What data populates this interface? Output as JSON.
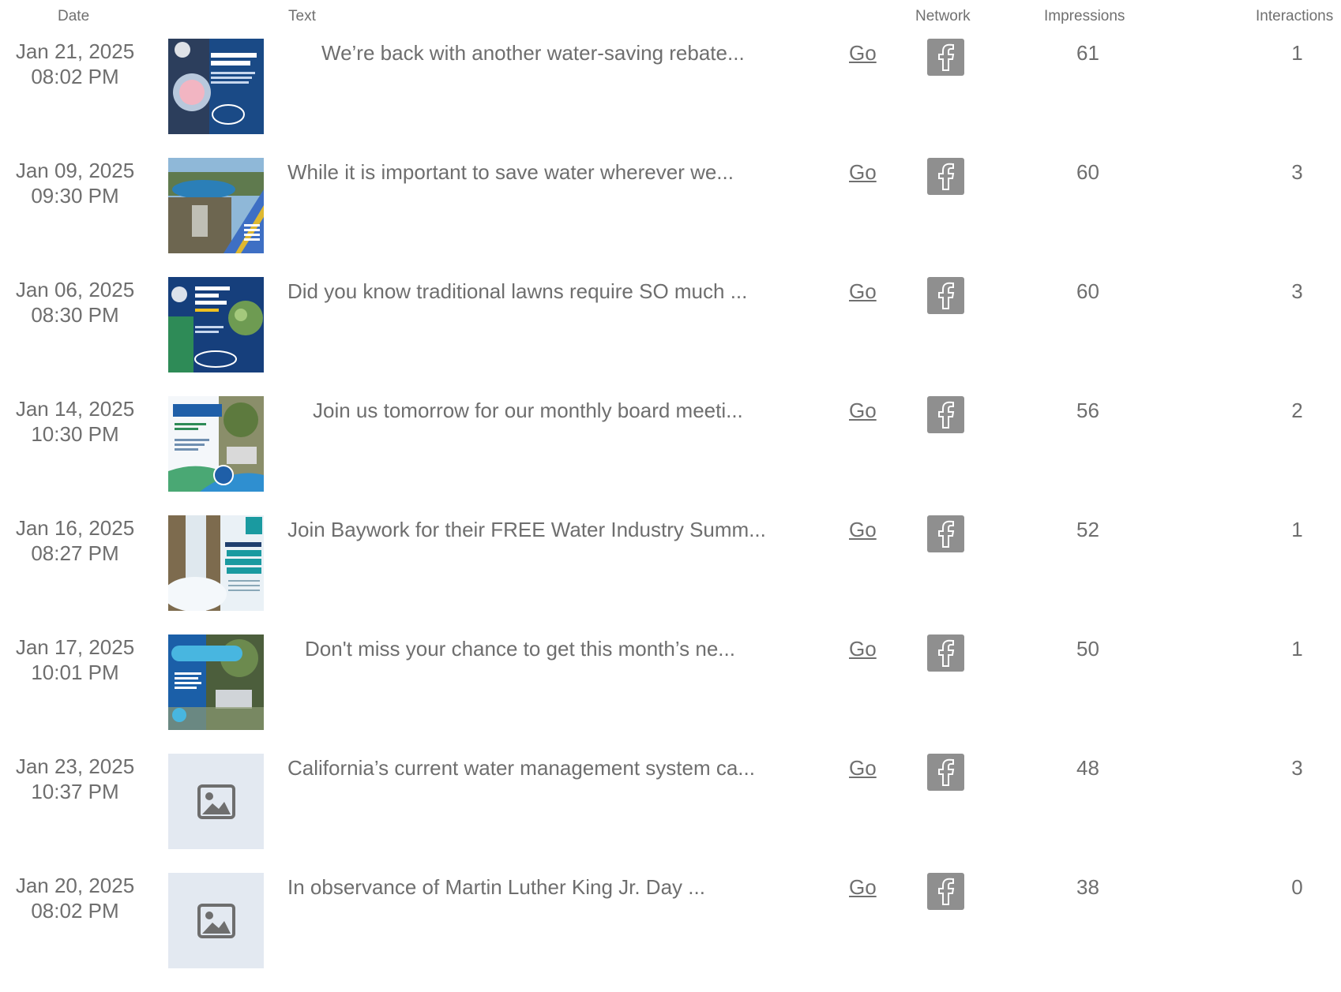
{
  "columns": {
    "date": "Date",
    "text": "Text",
    "network": "Network",
    "impressions": "Impressions",
    "interactions": "Interactions"
  },
  "go_label": "Go",
  "colors": {
    "text": "#6e6e6e",
    "facebook_tile": "#8f8f8f",
    "placeholder_bg": "#e3e9f1",
    "placeholder_icon": "#6e6e6e"
  },
  "rows": [
    {
      "date": "Jan 21, 2025",
      "time": "08:02 PM",
      "text": "We’re back with another water-saving rebate...",
      "impressions": "61",
      "interactions": "1",
      "network": "facebook-icon",
      "thumbnail": "washer-rebate-thumbnail"
    },
    {
      "date": "Jan 09, 2025",
      "time": "09:30 PM",
      "text": "While it is important to save water wherever we...",
      "impressions": "60",
      "interactions": "3",
      "network": "facebook-icon",
      "thumbnail": "reservoir-thumbnail"
    },
    {
      "date": "Jan 06, 2025",
      "time": "08:30 PM",
      "text": "Did you know traditional lawns require SO much ...",
      "impressions": "60",
      "interactions": "3",
      "network": "facebook-icon",
      "thumbnail": "lawn-conversion-thumbnail"
    },
    {
      "date": "Jan 14, 2025",
      "time": "10:30 PM",
      "text": "Join us tomorrow for our monthly board meeti...",
      "impressions": "56",
      "interactions": "2",
      "network": "facebook-icon",
      "thumbnail": "board-meeting-thumbnail"
    },
    {
      "date": "Jan 16, 2025",
      "time": "08:27 PM",
      "text": "Join Baywork for their FREE Water Industry Summ...",
      "impressions": "52",
      "interactions": "1",
      "network": "facebook-icon",
      "thumbnail": "summit-thumbnail"
    },
    {
      "date": "Jan 17, 2025",
      "time": "10:01 PM",
      "text": "Don't miss your chance to get this month’s ne...",
      "impressions": "50",
      "interactions": "1",
      "network": "facebook-icon",
      "thumbnail": "newsletter-thumbnail"
    },
    {
      "date": "Jan 23, 2025",
      "time": "10:37 PM",
      "text": "California’s current water management system ca...",
      "impressions": "48",
      "interactions": "3",
      "network": "facebook-icon",
      "thumbnail": "image-placeholder-icon"
    },
    {
      "date": "Jan 20, 2025",
      "time": "08:02 PM",
      "text": "In observance of Martin Luther King Jr. Day ...",
      "impressions": "38",
      "interactions": "0",
      "network": "facebook-icon",
      "thumbnail": "image-placeholder-icon"
    }
  ]
}
